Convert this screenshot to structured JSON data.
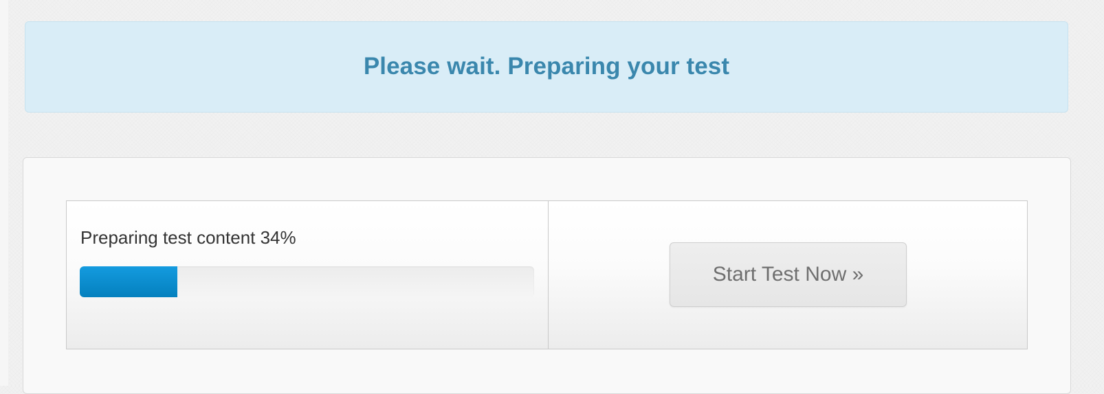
{
  "alert": {
    "title": "Please wait. Preparing your test"
  },
  "progress": {
    "label": "Preparing test content 34%",
    "percent": 34,
    "fill_fraction": 0.215,
    "color": "#0e8ed0"
  },
  "actions": {
    "start_label": "Start Test Now »",
    "start_disabled": true
  },
  "colors": {
    "alert_background": "#d9edf7",
    "alert_text": "#3a87ad",
    "progress_fill": "#0e8ed0"
  }
}
